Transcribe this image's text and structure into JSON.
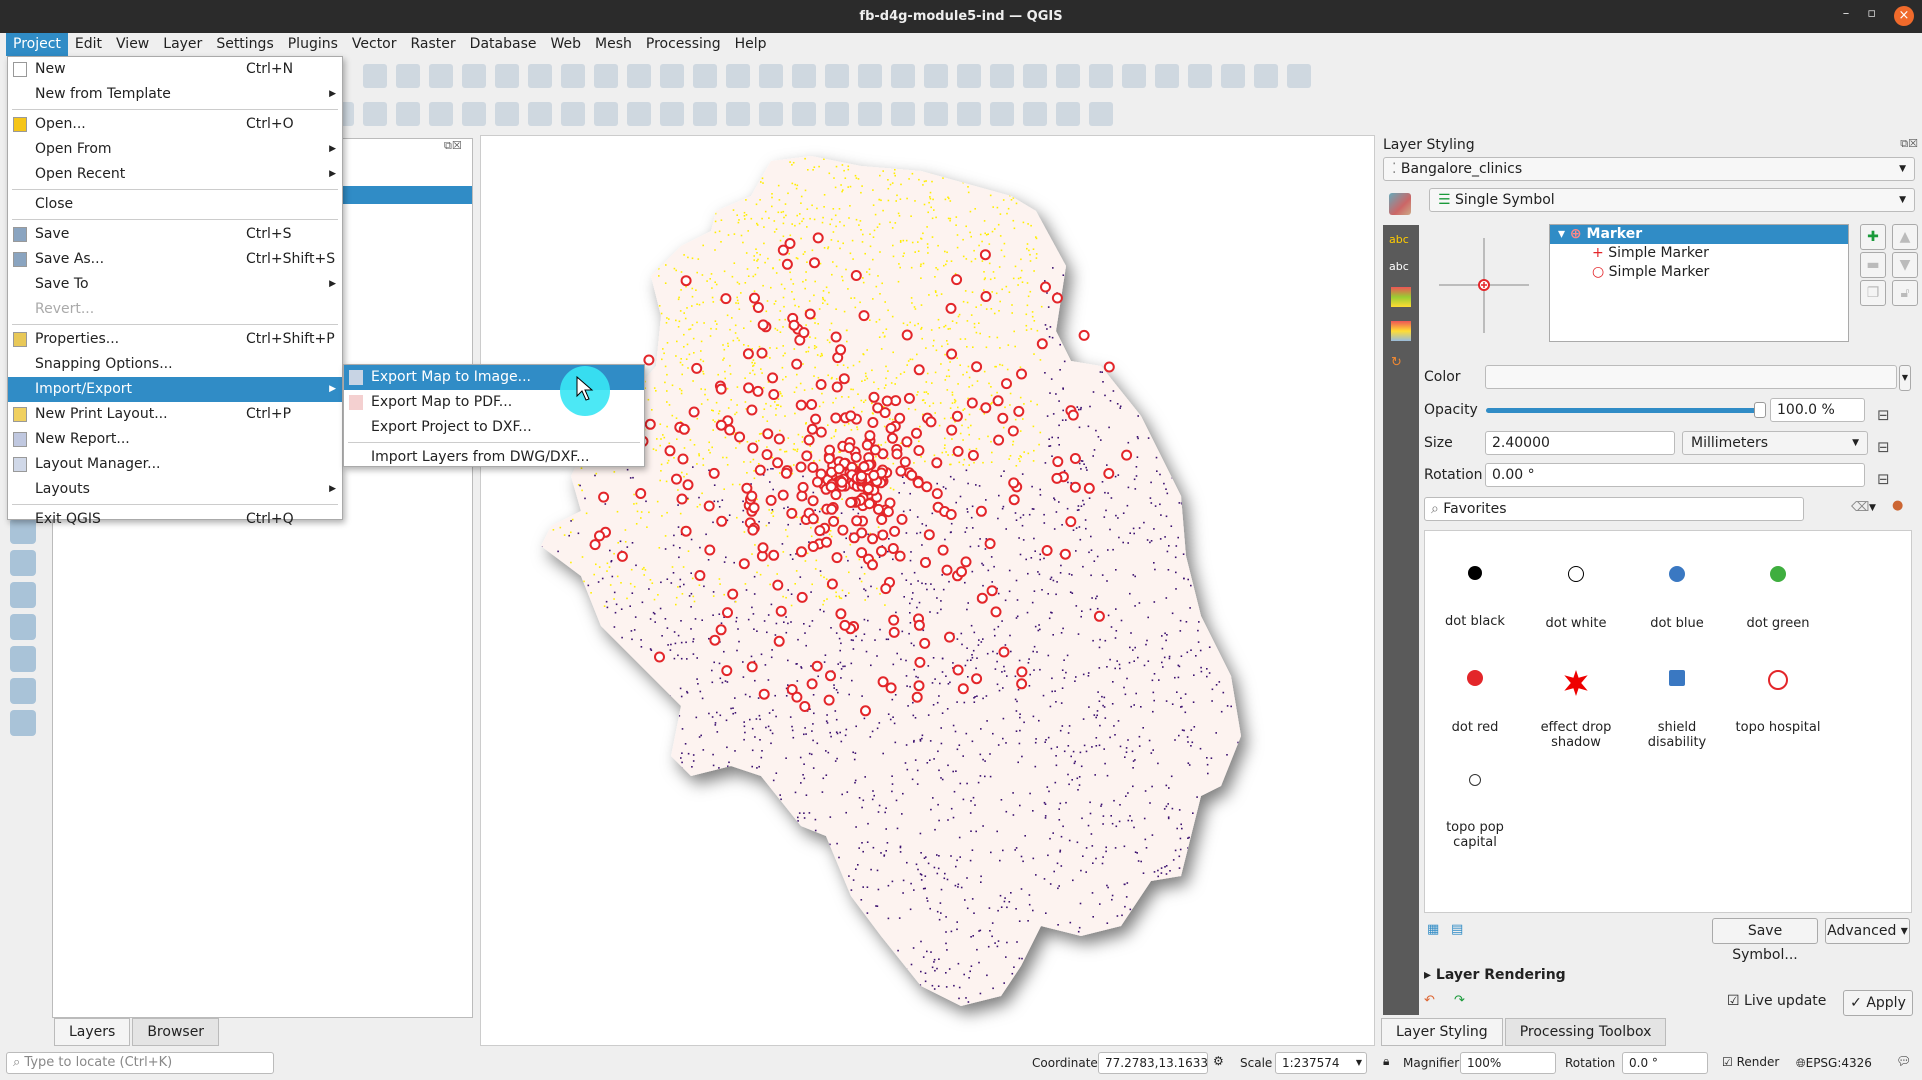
{
  "window": {
    "title": "fb-d4g-module5-ind — QGIS"
  },
  "menubar": [
    "Project",
    "Edit",
    "View",
    "Layer",
    "Settings",
    "Plugins",
    "Vector",
    "Raster",
    "Database",
    "Web",
    "Mesh",
    "Processing",
    "Help"
  ],
  "project_menu": [
    {
      "label": "New",
      "shortcut": "Ctrl+N"
    },
    {
      "label": "New from Template",
      "submenu": true
    },
    {
      "sep": true
    },
    {
      "label": "Open...",
      "shortcut": "Ctrl+O"
    },
    {
      "label": "Open From",
      "submenu": true
    },
    {
      "label": "Open Recent",
      "submenu": true
    },
    {
      "sep": true
    },
    {
      "label": "Close"
    },
    {
      "sep": true
    },
    {
      "label": "Save",
      "shortcut": "Ctrl+S"
    },
    {
      "label": "Save As...",
      "shortcut": "Ctrl+Shift+S"
    },
    {
      "label": "Save To",
      "submenu": true
    },
    {
      "label": "Revert...",
      "disabled": true
    },
    {
      "sep": true
    },
    {
      "label": "Properties...",
      "shortcut": "Ctrl+Shift+P"
    },
    {
      "label": "Snapping Options..."
    },
    {
      "label": "Import/Export",
      "submenu": true,
      "highlighted": true
    },
    {
      "label": "New Print Layout...",
      "shortcut": "Ctrl+P"
    },
    {
      "label": "New Report..."
    },
    {
      "label": "Layout Manager..."
    },
    {
      "label": "Layouts",
      "submenu": true
    },
    {
      "sep": true
    },
    {
      "label": "Exit QGIS",
      "shortcut": "Ctrl+Q"
    }
  ],
  "import_export_menu": [
    {
      "label": "Export Map to Image...",
      "highlighted": true
    },
    {
      "label": "Export Map to PDF..."
    },
    {
      "label": "Export Project to DXF..."
    },
    {
      "sep": true
    },
    {
      "label": "Import Layers from DWG/DXF..."
    }
  ],
  "layers_panel": {
    "tabs": [
      "Layers",
      "Browser"
    ]
  },
  "styling": {
    "title": "Layer Styling",
    "layer": "Bangalore_clinics",
    "renderer": "Single Symbol",
    "tree": {
      "root": "Marker",
      "children": [
        "Simple Marker",
        "Simple Marker"
      ]
    },
    "color_label": "Color",
    "opacity_label": "Opacity",
    "opacity": "100.0 %",
    "opacity_fraction": 1.0,
    "size_label": "Size",
    "size": "2.40000",
    "unit": "Millimeters",
    "rotation_label": "Rotation",
    "rotation": "0.00 °",
    "search": "Favorites",
    "symbols": [
      {
        "label": "dot  black",
        "color": "#000000"
      },
      {
        "label": "dot  white",
        "color": "#ffffff"
      },
      {
        "label": "dot blue",
        "color": "#3a78c2"
      },
      {
        "label": "dot green",
        "color": "#3fae3f"
      },
      {
        "label": "dot red",
        "color": "#e3262a"
      },
      {
        "label": "effect drop shadow",
        "color": "#ee0000"
      },
      {
        "label": "shield disability",
        "color": "#3a78c2"
      },
      {
        "label": "topo hospital",
        "color": "#e3262a"
      },
      {
        "label": "topo pop capital",
        "color": "#333333"
      }
    ],
    "save_symbol": "Save Symbol...",
    "advanced": "Advanced",
    "layer_rendering": "Layer Rendering",
    "live_update": "Live update",
    "apply": "Apply",
    "bottom_tabs": [
      "Layer Styling",
      "Processing Toolbox"
    ]
  },
  "status": {
    "locate_placeholder": "Type to locate (Ctrl+K)",
    "coordinate_label": "Coordinate",
    "coordinate": "77.2783,13.1633",
    "scale_label": "Scale",
    "scale": "1:237574",
    "magnifier_label": "Magnifier",
    "magnifier": "100%",
    "rotation_label": "Rotation",
    "rotation": "0.0 °",
    "render_label": "Render",
    "crs": "EPSG:4326"
  },
  "colors": {
    "accent": "#308cc6",
    "clinic": "#e3262a",
    "density_high": "#ffee00",
    "density_low": "#3b0f6f",
    "boundary_fill": "#fdf3f0"
  }
}
